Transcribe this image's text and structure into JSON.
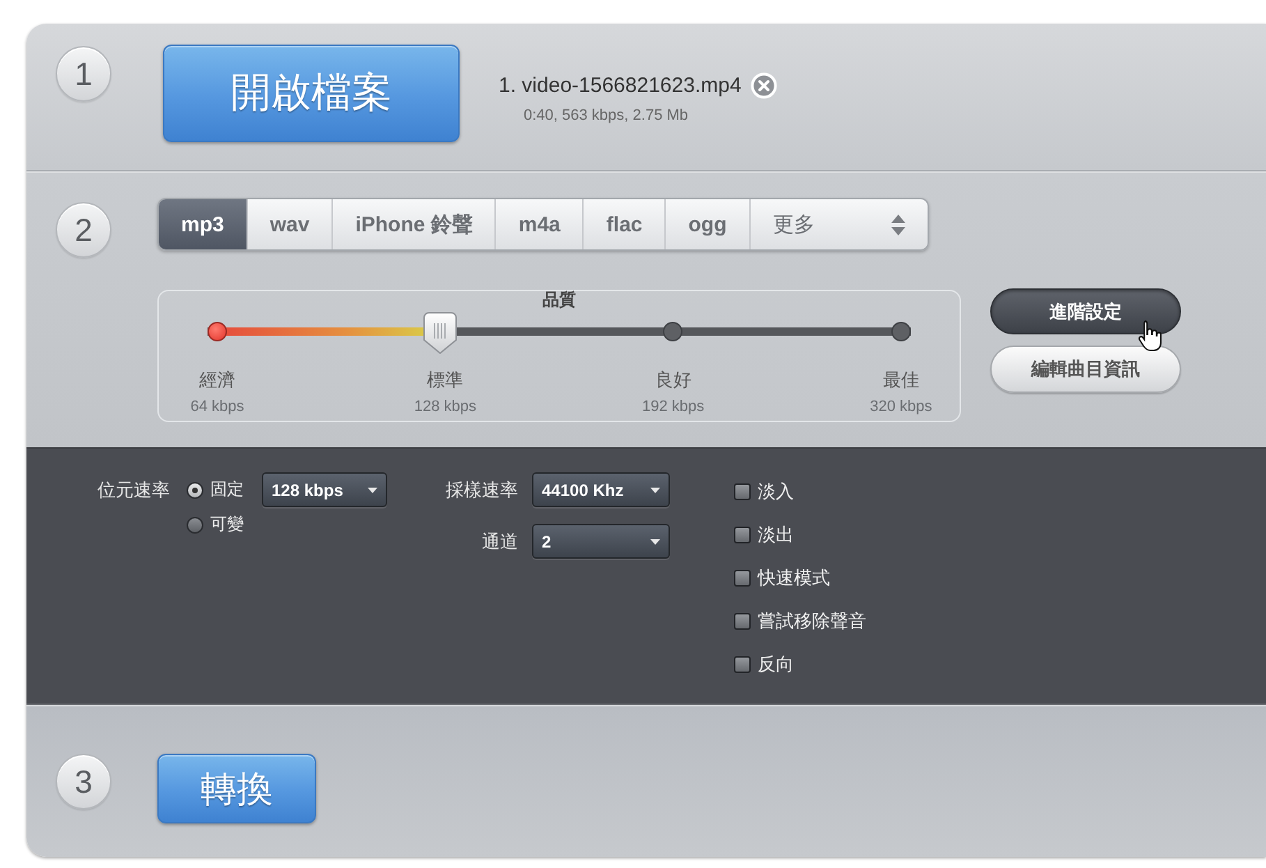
{
  "file_step": {
    "number": "1",
    "open_button": "開啟檔案",
    "files": [
      {
        "name": "1. video-1566821623.mp4",
        "details": "0:40, 563 kbps, 2.75 Mb"
      }
    ]
  },
  "format_step": {
    "number": "2",
    "tabs": [
      {
        "label": "mp3",
        "kind": "tab",
        "selected": true
      },
      {
        "label": "wav",
        "kind": "tab",
        "selected": false
      },
      {
        "label": "iPhone 鈴聲",
        "kind": "tab",
        "selected": false
      },
      {
        "label": "m4a",
        "kind": "tab",
        "selected": false
      },
      {
        "label": "flac",
        "kind": "tab",
        "selected": false
      },
      {
        "label": "ogg",
        "kind": "tab",
        "selected": false
      },
      {
        "label": "更多",
        "kind": "dropdown",
        "selected": false
      }
    ],
    "quality": {
      "title": "品質",
      "level": 0.33,
      "stops": [
        {
          "label": "經濟",
          "reading": "64 kbps"
        },
        {
          "label": "標準",
          "reading": "128 kbps"
        },
        {
          "label": "良好",
          "reading": "192 kbps"
        },
        {
          "label": "最佳",
          "reading": "320 kbps"
        }
      ]
    },
    "buttons": [
      {
        "label": "進階設定",
        "pressed": true
      },
      {
        "label": "編輯曲目資訊",
        "pressed": false
      }
    ]
  },
  "advanced": {
    "bitrate": {
      "label": "位元速率",
      "modes": [
        {
          "label": "固定",
          "selected": true
        },
        {
          "label": "可變",
          "selected": false
        }
      ],
      "value": "128 kbps"
    },
    "sample_rate": {
      "label": "採樣速率",
      "value": "44100 Khz"
    },
    "channels": {
      "label": "通道",
      "value": "2"
    },
    "options": [
      {
        "label": "淡入",
        "checked": false
      },
      {
        "label": "淡出",
        "checked": false
      },
      {
        "label": "快速模式",
        "checked": false
      },
      {
        "label": "嘗試移除聲音",
        "checked": false
      },
      {
        "label": "反向",
        "checked": false
      }
    ]
  },
  "convert_step": {
    "number": "3",
    "button": "轉換"
  }
}
